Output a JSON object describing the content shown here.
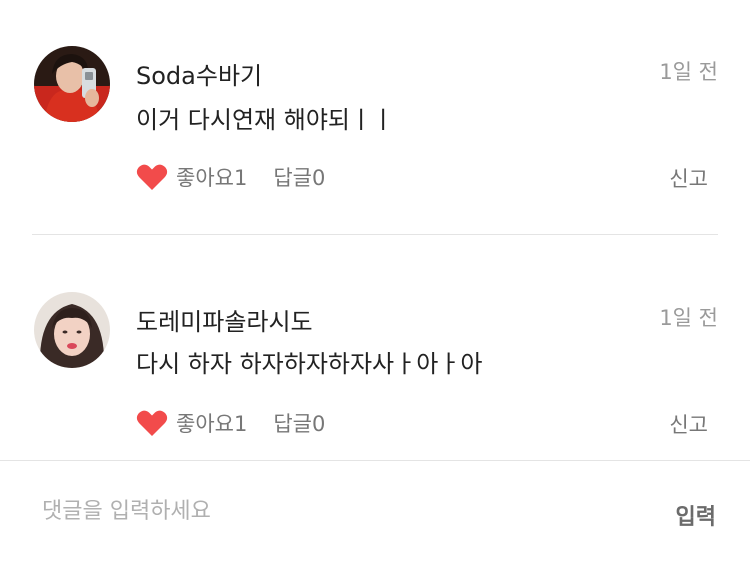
{
  "comments": [
    {
      "author": "Soda수바기",
      "text": "이거 다시연재 해야되ㅣㅣ",
      "time": "1일 전",
      "likes_label": "좋아요1",
      "replies_label": "답글0",
      "report_label": "신고",
      "avatar_icon": "user-photo-avatar"
    },
    {
      "author": "도레미파솔라시도",
      "text": "다시 하자 하자하자하자사ㅏ아ㅏ아",
      "time": "1일 전",
      "likes_label": "좋아요1",
      "replies_label": "답글0",
      "report_label": "신고",
      "avatar_icon": "user-photo-avatar"
    }
  ],
  "input": {
    "placeholder": "댓글을 입력하세요",
    "value": "",
    "submit_label": "입력"
  },
  "colors": {
    "heart": "#f24b4b",
    "divider": "#e4e4e4",
    "muted_text": "#9a9a9a"
  },
  "icons": {
    "like": "heart-icon"
  }
}
